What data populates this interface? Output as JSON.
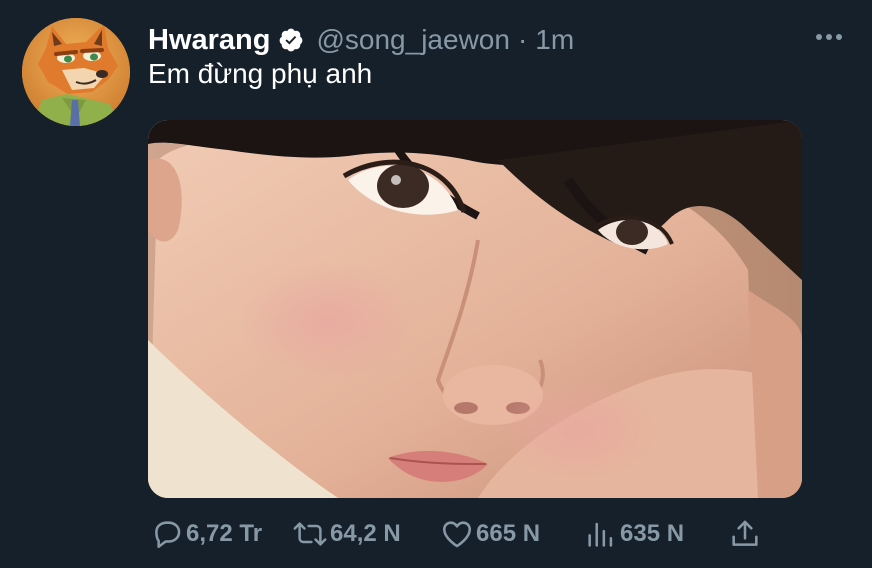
{
  "tweet": {
    "author": {
      "display_name": "Hwarang",
      "handle": "@song_jaewon",
      "verified": true,
      "avatar_icon": "fox-avatar"
    },
    "separator": "·",
    "timestamp": "1m",
    "text": "Em đừng phụ anh",
    "media": {
      "icon": "photo-portrait"
    },
    "actions": {
      "reply": {
        "icon": "reply-icon",
        "count": "6,72 Tr"
      },
      "retweet": {
        "icon": "retweet-icon",
        "count": "64,2 N"
      },
      "like": {
        "icon": "heart-icon",
        "count": "665 N"
      },
      "views": {
        "icon": "analytics-icon",
        "count": "635 N"
      },
      "share": {
        "icon": "share-icon"
      }
    }
  },
  "colors": {
    "background": "#15202b",
    "primary_text": "#ffffff",
    "secondary_text": "#8899a6",
    "icon_gray": "#8899a6"
  }
}
